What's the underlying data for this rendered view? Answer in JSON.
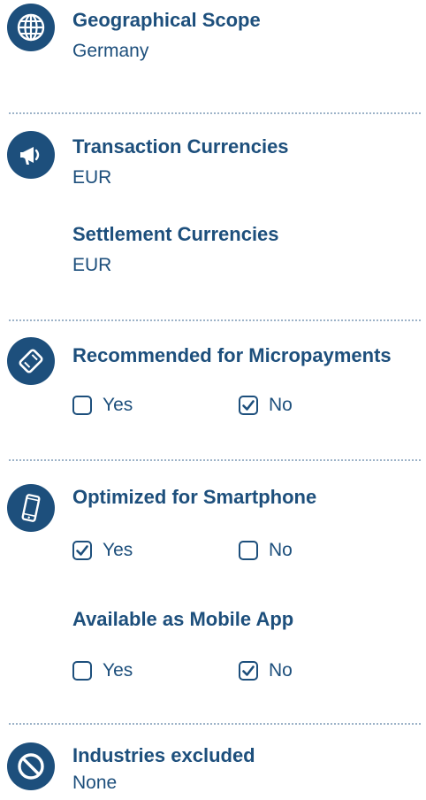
{
  "geo": {
    "title": "Geographical Scope",
    "value": "Germany",
    "icon": "globe-icon"
  },
  "currencies": {
    "transaction_title": "Transaction Currencies",
    "transaction_value": "EUR",
    "settlement_title": "Settlement Currencies",
    "settlement_value": "EUR",
    "icon": "megaphone-icon"
  },
  "micropayments": {
    "title": "Recommended for Micropayments",
    "yes_label": "Yes",
    "yes_checked": false,
    "no_label": "No",
    "no_checked": true,
    "icon": "card-ticket-icon"
  },
  "smartphone": {
    "title": "Optimized for Smartphone",
    "yes_label": "Yes",
    "yes_checked": true,
    "no_label": "No",
    "no_checked": false,
    "icon": "smartphone-icon"
  },
  "mobile_app": {
    "title": "Available as Mobile App",
    "yes_label": "Yes",
    "yes_checked": false,
    "no_label": "No",
    "no_checked": true
  },
  "industries": {
    "title": "Industries excluded",
    "value": "None",
    "icon": "prohibited-icon"
  },
  "colors": {
    "primary": "#1d4f7c",
    "divider": "#9db3c8"
  }
}
